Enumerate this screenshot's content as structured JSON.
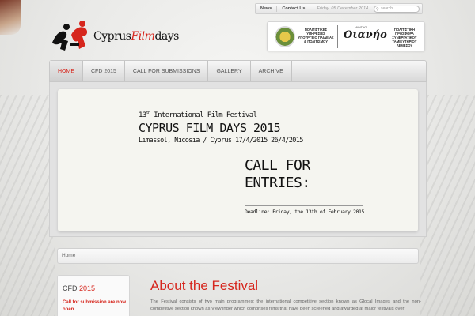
{
  "topbar": {
    "links": [
      "News",
      "Contact Us"
    ],
    "date": "Friday, 05 December 2014",
    "search_placeholder": "search..."
  },
  "logo": {
    "text_main": "Cyprus",
    "text_accent": "Film",
    "text_end": "days"
  },
  "sponsor": {
    "left_text": "ΠΟΛΙΤΙΣΤΙΚΕΣ ΥΠΗΡΕΣΙΕΣ ΥΠΟΥΡΓΕΙΟ ΠΑΙΔΕΙΑΣ & ΠΟΛΙΤΙΣΜΟΥ",
    "brand": "Οιανήο",
    "brand_small": "ΜΑΝΤΗΟ",
    "right_text": "ΠΟΛΙΤΙΣΤΙΚΗ ΠΡΟΣΦΟΡΑ ΣΥΝΕΡΓΑΤΙΚΟΥ ΤΑΜΙΕΥΤΗΡΙΟΥ ΛΕΜΕΣΟΥ"
  },
  "nav": {
    "items": [
      {
        "label": "HOME",
        "active": true
      },
      {
        "label": "CFD 2015",
        "active": false
      },
      {
        "label": "CALL FOR SUBMISSIONS",
        "active": false
      },
      {
        "label": "GALLERY",
        "active": false
      },
      {
        "label": "ARCHIVE",
        "active": false
      }
    ]
  },
  "banner": {
    "edition_num": "13",
    "edition_sup": "th",
    "edition_rest": " International Film Festival",
    "title": "CYPRUS FILM DAYS 2015",
    "subtitle": "Limassol, Nicosia / Cyprus 17/4/2015 26/4/2015",
    "call": "CALL FOR\nENTRIES:",
    "deadline": "Deadline: Friday, the 13th of February 2015"
  },
  "breadcrumb": {
    "home": "Home"
  },
  "sidebar": {
    "title_prefix": "CFD ",
    "title_year": "2015",
    "link": "Call for submission are now open"
  },
  "main": {
    "title": "About the Festival",
    "text": "The Festival consists of two main programmes: the international competitive section known as Glocal Images and the non-competitive section known as Viewfinder which comprises films that have been screened and awarded at major festivals over"
  },
  "colors": {
    "accent": "#d6261d",
    "background": "#e8e8e6"
  }
}
